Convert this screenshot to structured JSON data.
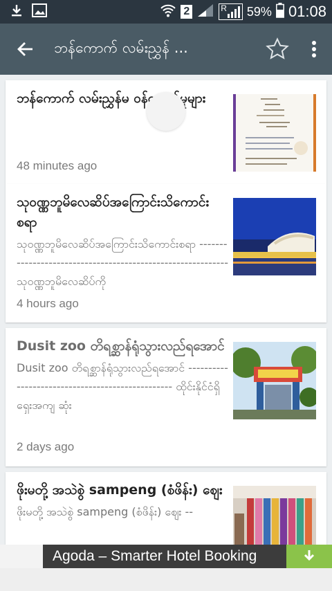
{
  "status_bar": {
    "battery_percent": "59%",
    "time": "01:08",
    "sim_badge": "2",
    "roaming_badge": "R"
  },
  "app_bar": {
    "title": "ဘန်ကောက် လမ်းညွှန် ..."
  },
  "articles": [
    {
      "title": "ဘန်ကောက် လမ်းညွှန်မ ဝန်ဆောင်မှုများ",
      "snippet": "",
      "time": "48 minutes ago",
      "thumb": "document-thumbnail"
    },
    {
      "title": "သုဝဏ္ဏဘူမိလေဆိပ်အကြောင်းသိကောင်းစရာ",
      "snippet": "သုဝဏ္ဏဘူမိလေဆိပ်အကြောင်းသိကောင်းစရာ ------------------------------------------------------------ သုဝဏ္ဏဘူမိလေဆိပ်ကို",
      "time": "4 hours ago",
      "thumb": "airport-night-photo"
    },
    {
      "title": "Dusit zoo တိရစ္ဆာန်ရုံသွားလည်ရအောင်",
      "snippet": "Dusit zoo တိရစ္ဆာန်ရုံသွားလည်ရအောင် ------------------------------------------------- ထိုင်းနိုင်ငံရှိ ရှေးအကျ ဆုံး",
      "time": "2 days ago",
      "thumb": "zoo-entrance-photo"
    },
    {
      "title": "ဖိုးမတို့ အသဲစွဲ sampeng (စံဖိန်း) ဈေး",
      "snippet": "ဖိုးမတို့ အသဲစွဲ sampeng (စံဖိန်း) ဈေး --",
      "time": "",
      "thumb": "market-fabric-photo"
    }
  ],
  "ad": {
    "text": "Agoda – Smarter Hotel Booking"
  },
  "colors": {
    "status_bar": "#2b3640",
    "app_bar": "#4a5b65",
    "background": "#eceff1",
    "ad_download": "#8bc34a"
  }
}
